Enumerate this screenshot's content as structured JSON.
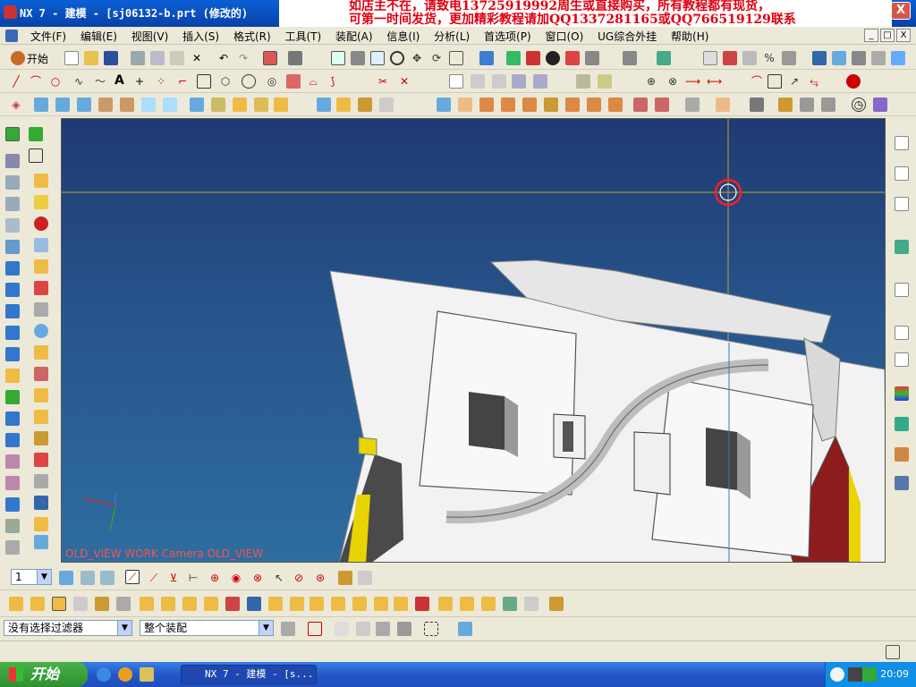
{
  "window": {
    "title": "NX 7 - 建模 - [sj06132-b.prt  (修改的)",
    "min_label": "_",
    "max_label": "□",
    "close_label": "X"
  },
  "banner": {
    "line1": "如店主不在，请致电13725919992周生或直接购买，所有教程都有现货，",
    "line2": "可第一时间发货，更加精彩教程请加QQ1337281165或QQ766519129联系"
  },
  "menu": {
    "items": [
      "文件(F)",
      "编辑(E)",
      "视图(V)",
      "插入(S)",
      "格式(R)",
      "工具(T)",
      "装配(A)",
      "信息(I)",
      "分析(L)",
      "首选项(P)",
      "窗口(O)",
      "UG综合外挂",
      "帮助(H)"
    ]
  },
  "toolbar": {
    "start_label": "开始",
    "text_tool_label": "A"
  },
  "viewport": {
    "view_label": "OLD_VIEW WORK  Camera OLD_VIEW",
    "background_top": "#1f3a72",
    "background_bottom": "#2e6d9f"
  },
  "bottom_toolbar": {
    "layer_value": "1"
  },
  "filter": {
    "type_filter": "没有选择过滤器",
    "assembly_scope": "整个装配"
  },
  "taskbar": {
    "start_label": "开始",
    "active_task": "NX 7 - 建模 - [s...",
    "clock": "20:09"
  },
  "colors": {
    "accent_red": "#e00010",
    "xp_blue": "#2456c8",
    "part_white": "#f2f2f2",
    "part_red": "#8e1c1c",
    "part_yellow": "#e8d400"
  }
}
